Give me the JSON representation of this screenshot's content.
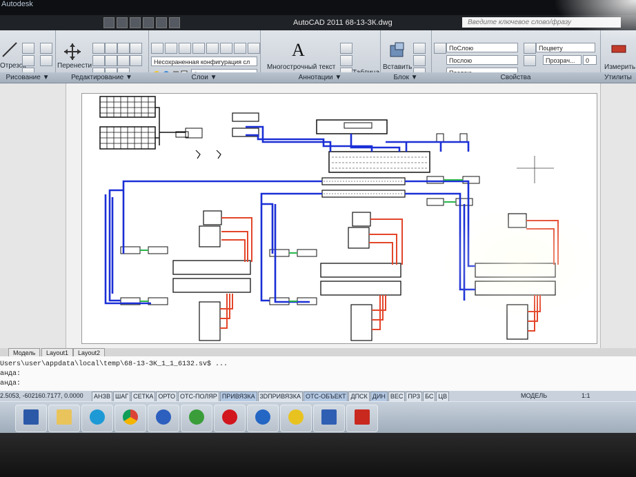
{
  "app": {
    "logo": "Autodesk",
    "title": "AutoCAD 2011    68-13-ЗК.dwg",
    "search_placeholder": "Введите ключевое слово/фразу"
  },
  "ribbon": {
    "draw": {
      "cut_label": "Отрезок",
      "group_label": "Рисование ▼"
    },
    "modify": {
      "move_label": "Перенести",
      "group_label": "Редактирование ▼"
    },
    "layers": {
      "config_value": "Несохраненная конфигурация сл",
      "layer_value": "0",
      "group_label": "Слои ▼"
    },
    "annotations": {
      "mtext_label": "Многострочный текст",
      "mtext_icon": "A",
      "table_label": "Таблица",
      "group_label": "Аннотации ▼"
    },
    "block": {
      "insert_label": "Вставить",
      "group_label": "Блок ▼"
    },
    "properties": {
      "color_value": "ПоСлою",
      "linetype_value": "Послою",
      "lineweight_value": "Послою",
      "list_value": "Поцвету",
      "transparency_label": "Прозрач...",
      "transparency_value": "0",
      "group_label": "Свойства"
    },
    "measure": {
      "label": "Измерить",
      "group_label": "Утилиты"
    }
  },
  "tabs": {
    "model": "Модель",
    "layout1": "Layout1",
    "layout2": "Layout2"
  },
  "command": {
    "line1": "Users\\user\\appdata\\local\\temp\\68-13-ЗК_1_1_6132.sv$ ...",
    "line2": "анда:",
    "line3": "анда:"
  },
  "status": {
    "coords": "2.5053, -602160.7177, 0.0000",
    "buttons": [
      "АНЗВ",
      "ШАГ",
      "СЕТКА",
      "ОРТО",
      "ОТС-ПОЛЯР",
      "ПРИВЯЗКА",
      "3DПРИВЯЗКА",
      "ОТС-ОБЪЕКТ",
      "ДПСК",
      "ДИН",
      "ВЕС",
      "ПРЗ",
      "БС",
      "ЦВ"
    ],
    "model_label": "МОДЕЛЬ",
    "scale": "1:1"
  },
  "taskbar": {
    "items": [
      "save-icon",
      "explorer-icon",
      "skype-icon",
      "chrome-icon",
      "plus-icon",
      "utorrent-icon",
      "opera-icon",
      "opera-blue-icon",
      "batman-icon",
      "word-icon",
      "autocad-icon"
    ]
  },
  "colors": {
    "blue": "#1a2fd6",
    "red": "#e3452a",
    "green": "#28b44a",
    "black": "#111111"
  }
}
